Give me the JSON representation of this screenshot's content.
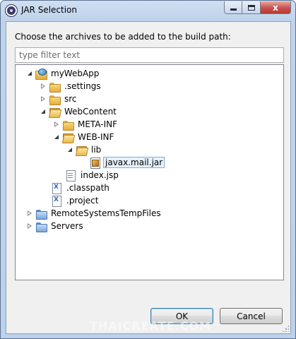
{
  "window": {
    "title": "JAR Selection",
    "controls": {
      "minimize": "minimize",
      "maximize": "maximize",
      "close": "x"
    }
  },
  "dialog": {
    "prompt": "Choose the archives to be added to the build path:",
    "filter_placeholder": "type filter text",
    "filter_value": ""
  },
  "tree": {
    "items": [
      {
        "label": "myWebApp",
        "icon": "project-icon",
        "expander": "open"
      },
      {
        "label": ".settings",
        "icon": "folder-icon",
        "expander": "closed"
      },
      {
        "label": "src",
        "icon": "folder-icon",
        "expander": "closed"
      },
      {
        "label": "WebContent",
        "icon": "folder-open-icon",
        "expander": "open"
      },
      {
        "label": "META-INF",
        "icon": "folder-icon",
        "expander": "closed"
      },
      {
        "label": "WEB-INF",
        "icon": "folder-open-icon",
        "expander": "open"
      },
      {
        "label": "lib",
        "icon": "folder-open-icon",
        "expander": "open"
      },
      {
        "label": "javax.mail.jar",
        "icon": "jar-icon",
        "expander": "none",
        "selected": true
      },
      {
        "label": "index.jsp",
        "icon": "file-icon",
        "expander": "none"
      },
      {
        "label": ".classpath",
        "icon": "xml-file-icon",
        "expander": "none"
      },
      {
        "label": ".project",
        "icon": "xml-file-icon",
        "expander": "none"
      },
      {
        "label": "RemoteSystemsTempFiles",
        "icon": "project-folder-icon",
        "expander": "closed"
      },
      {
        "label": "Servers",
        "icon": "project-folder-icon",
        "expander": "closed"
      }
    ]
  },
  "buttons": {
    "ok": "OK",
    "cancel": "Cancel"
  },
  "watermark": "THAICREATE.COM"
}
